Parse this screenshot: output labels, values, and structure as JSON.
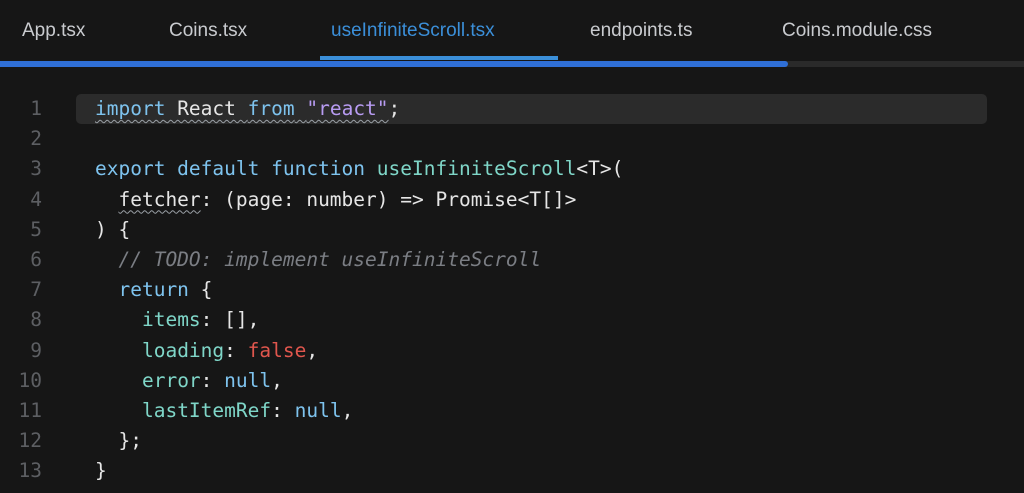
{
  "tabs": [
    {
      "label": "App.tsx",
      "active": false
    },
    {
      "label": "Coins.tsx",
      "active": false
    },
    {
      "label": "useInfiniteScroll.tsx",
      "active": true
    },
    {
      "label": "endpoints.ts",
      "active": false
    },
    {
      "label": "Coins.module.css",
      "active": false
    }
  ],
  "scroll_progress_fraction": 0.77,
  "colors": {
    "background": "#161616",
    "active_tab": "#3b8fd9",
    "keyword": "#7ec3ee",
    "function": "#7fd6c8",
    "string": "#b89cf2",
    "boolean": "#e0564d",
    "comment": "#7b7e84"
  },
  "editor": {
    "current_line": 1,
    "lines": [
      {
        "number": "1",
        "indent": "",
        "tokens": [
          {
            "text": "import",
            "type": "kw",
            "squiggle": true
          },
          {
            "text": " React ",
            "type": "plain",
            "squiggle": true
          },
          {
            "text": "from",
            "type": "kw",
            "squiggle": true
          },
          {
            "text": " ",
            "type": "plain",
            "squiggle": true
          },
          {
            "text": "\"react\"",
            "type": "str",
            "squiggle": true
          },
          {
            "text": ";",
            "type": "plain"
          }
        ]
      },
      {
        "number": "2",
        "indent": "",
        "tokens": []
      },
      {
        "number": "3",
        "indent": "",
        "tokens": [
          {
            "text": "export default function ",
            "type": "kw"
          },
          {
            "text": "useInfiniteScroll",
            "type": "fn"
          },
          {
            "text": "<T>(",
            "type": "plain"
          }
        ]
      },
      {
        "number": "4",
        "indent": "  ",
        "tokens": [
          {
            "text": "fetcher",
            "type": "plain",
            "squiggle": true
          },
          {
            "text": ": (page: number) => Promise<T[]>",
            "type": "plain"
          }
        ]
      },
      {
        "number": "5",
        "indent": "",
        "tokens": [
          {
            "text": ") {",
            "type": "plain"
          }
        ]
      },
      {
        "number": "6",
        "indent": "  ",
        "tokens": [
          {
            "text": "// TODO: implement useInfiniteScroll",
            "type": "cmt"
          }
        ]
      },
      {
        "number": "7",
        "indent": "  ",
        "tokens": [
          {
            "text": "return",
            "type": "kw"
          },
          {
            "text": " {",
            "type": "plain"
          }
        ]
      },
      {
        "number": "8",
        "indent": "    ",
        "tokens": [
          {
            "text": "items",
            "type": "fn"
          },
          {
            "text": ": [],",
            "type": "plain"
          }
        ]
      },
      {
        "number": "9",
        "indent": "    ",
        "tokens": [
          {
            "text": "loading",
            "type": "fn"
          },
          {
            "text": ": ",
            "type": "plain"
          },
          {
            "text": "false",
            "type": "bool"
          },
          {
            "text": ",",
            "type": "plain"
          }
        ]
      },
      {
        "number": "10",
        "indent": "    ",
        "tokens": [
          {
            "text": "error",
            "type": "fn"
          },
          {
            "text": ": ",
            "type": "plain"
          },
          {
            "text": "null",
            "type": "kw"
          },
          {
            "text": ",",
            "type": "plain"
          }
        ]
      },
      {
        "number": "11",
        "indent": "    ",
        "tokens": [
          {
            "text": "lastItemRef",
            "type": "fn"
          },
          {
            "text": ": ",
            "type": "plain"
          },
          {
            "text": "null",
            "type": "kw"
          },
          {
            "text": ",",
            "type": "plain"
          }
        ]
      },
      {
        "number": "12",
        "indent": "  ",
        "tokens": [
          {
            "text": "};",
            "type": "plain"
          }
        ]
      },
      {
        "number": "13",
        "indent": "",
        "tokens": [
          {
            "text": "}",
            "type": "plain"
          }
        ]
      }
    ]
  }
}
